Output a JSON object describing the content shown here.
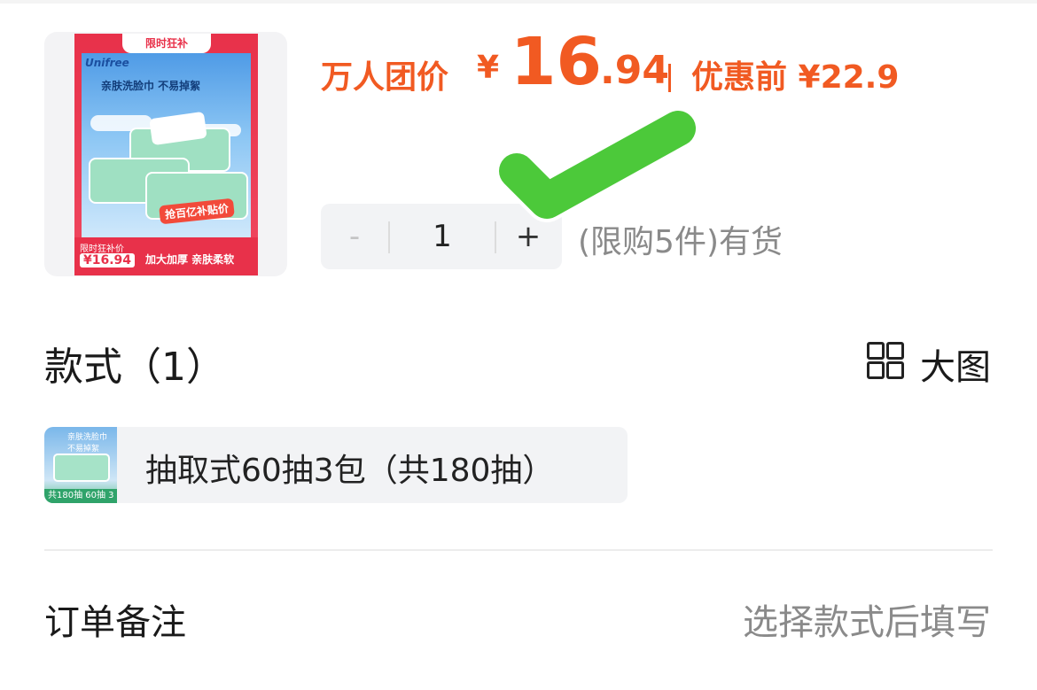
{
  "product": {
    "image_tag": "限时狂补",
    "image_brand": "Unifree",
    "image_slogan": "亲肤洗脸巾 不易掉絮",
    "image_badge": "抢百亿补贴价",
    "image_bottom_small": "限时狂补价",
    "image_bottom_price": "¥16.94",
    "image_bottom_feature": "加大加厚 亲肤柔软"
  },
  "price": {
    "label": "万人团价",
    "currency": "¥",
    "integer": "16",
    "decimal": ".94",
    "before_label": "优惠前 ¥22.9"
  },
  "quantity": {
    "minus": "-",
    "value": "1",
    "plus": "+",
    "stock_text": "(限购5件)有货"
  },
  "styles": {
    "title": "款式（1）",
    "big_view_label": "大图",
    "big_view_icon": "grid-icon",
    "options": [
      {
        "label": "抽取式60抽3包（共180抽）",
        "thumb_top": "亲肤洗脸巾 不易掉絮",
        "thumb_foot": "共180抽 60抽 3包"
      }
    ]
  },
  "remark": {
    "label": "订单备注",
    "hint": "选择款式后填写"
  },
  "overlay": {
    "icon": "checkmark-icon",
    "color": "#4cc93a"
  },
  "colors": {
    "accent": "#f15a22",
    "muted": "#8a8a8a",
    "field_bg": "#f2f3f5"
  }
}
